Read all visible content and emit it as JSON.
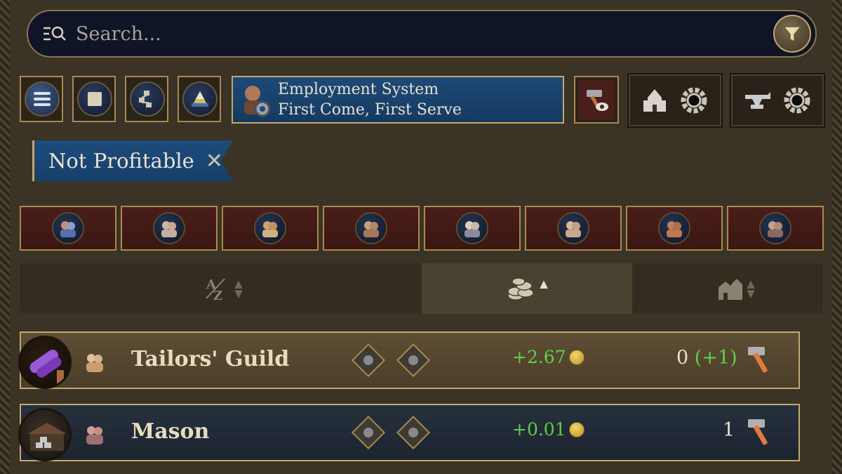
{
  "search": {
    "placeholder": "Search..."
  },
  "toolbar": {
    "employment_title": "Employment System",
    "employment_value": "First Come, First Serve"
  },
  "filter_tag": {
    "label": "Not Profitable"
  },
  "pop_tabs": [
    "pop-1",
    "pop-2",
    "pop-3",
    "pop-4",
    "pop-5",
    "pop-6",
    "pop-7",
    "pop-8"
  ],
  "sort": {
    "active": "profit",
    "direction": "ascending"
  },
  "buildings": [
    {
      "name": "Tailors' Guild",
      "profit": "+2.67",
      "level": "0",
      "level_plus": "(+1)",
      "selected": true
    },
    {
      "name": "Mason",
      "profit": "+0.01",
      "level": "1",
      "level_plus": "",
      "selected": false
    }
  ],
  "colors": {
    "panel": "#3b3326",
    "gold_border": "#c4a86a",
    "profit_green": "#5fcf4a",
    "blue_field": "#1d4a78"
  }
}
